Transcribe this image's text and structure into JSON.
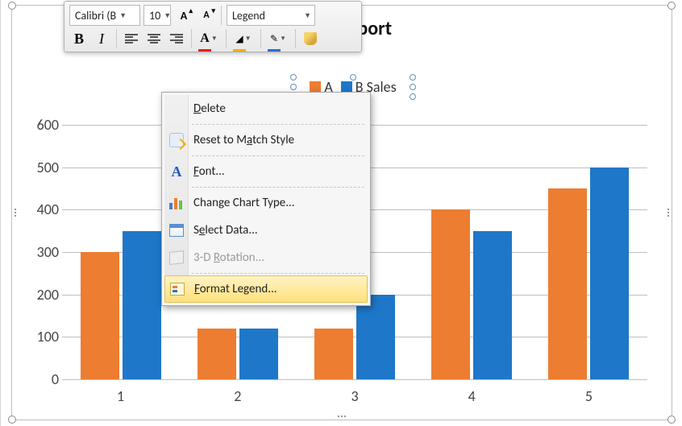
{
  "chart_data": {
    "type": "bar",
    "title": "Sales Report",
    "categories": [
      "1",
      "2",
      "3",
      "4",
      "5"
    ],
    "series": [
      {
        "name": "A",
        "values": [
          300,
          120,
          120,
          400,
          450
        ],
        "color": "#ed7d31"
      },
      {
        "name": "B Sales",
        "values": [
          350,
          120,
          200,
          350,
          500
        ],
        "color": "#1f77c9"
      }
    ],
    "ylabel": "",
    "xlabel": "",
    "ylim": [
      0,
      600
    ],
    "yticks": [
      0,
      100,
      200,
      300,
      400,
      500,
      600
    ],
    "legend_position": "top"
  },
  "mini_toolbar": {
    "font_name": "Calibri (B",
    "font_size": "10",
    "element_box": "Legend",
    "grow_font": "A",
    "shrink_font": "A",
    "bold": "B",
    "italic": "I"
  },
  "context_menu": {
    "items": [
      {
        "label": "Delete",
        "key": "D",
        "icon": null,
        "enabled": true
      },
      {
        "label": "Reset to Match Style",
        "key": "a",
        "icon": "reset",
        "enabled": true
      },
      {
        "label": "Font...",
        "key": "F",
        "icon": "font",
        "enabled": true
      },
      {
        "label": "Change Chart Type...",
        "key": "",
        "icon": "chart",
        "enabled": true
      },
      {
        "label": "Select Data...",
        "key": "e",
        "icon": "data",
        "enabled": true
      },
      {
        "label": "3-D Rotation...",
        "key": "R",
        "icon": "3d",
        "enabled": false
      },
      {
        "label": "Format Legend...",
        "key": "F",
        "icon": "legend",
        "enabled": true,
        "hover": true
      }
    ]
  }
}
